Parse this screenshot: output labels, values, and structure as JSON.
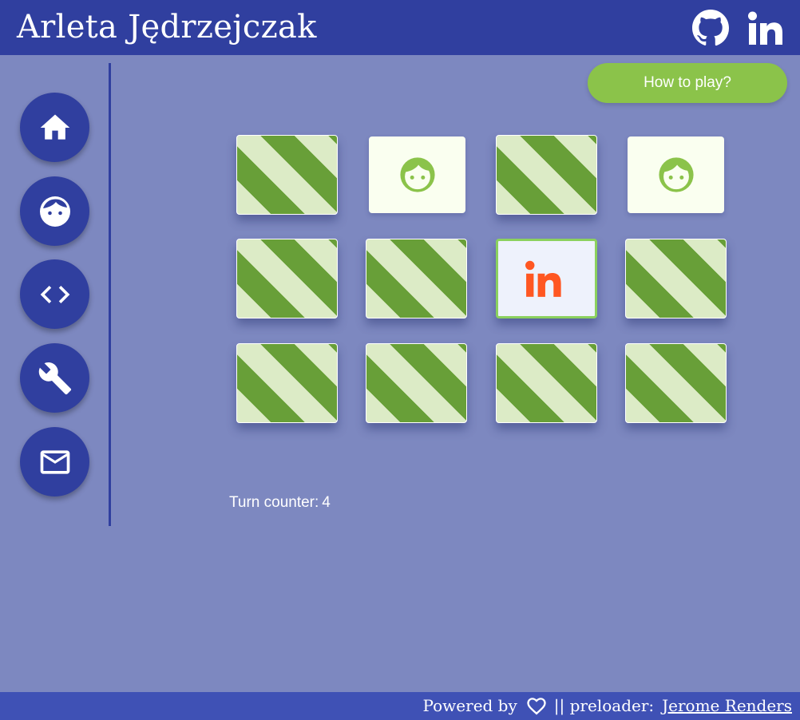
{
  "header": {
    "title": "Arleta Jędrzejczak",
    "icons": [
      "github-icon",
      "linkedin-icon"
    ]
  },
  "sidebar": {
    "items": [
      {
        "icon": "home-icon"
      },
      {
        "icon": "face-icon"
      },
      {
        "icon": "code-icon"
      },
      {
        "icon": "wrench-icon"
      },
      {
        "icon": "mail-icon"
      }
    ]
  },
  "game": {
    "how_to_play_label": "How to play?",
    "turn_counter_label": "Turn counter:",
    "turn_counter_value": "4",
    "cards": [
      {
        "state": "hidden"
      },
      {
        "state": "revealed",
        "icon": "face-icon"
      },
      {
        "state": "hidden"
      },
      {
        "state": "revealed",
        "icon": "face-icon"
      },
      {
        "state": "hidden"
      },
      {
        "state": "hidden"
      },
      {
        "state": "selected",
        "icon": "linkedin-icon"
      },
      {
        "state": "hidden"
      },
      {
        "state": "hidden"
      },
      {
        "state": "hidden"
      },
      {
        "state": "hidden"
      },
      {
        "state": "hidden"
      }
    ]
  },
  "footer": {
    "powered_by": "Powered by",
    "heart_icon": "heart-icon",
    "preloader_label": "|| preloader:",
    "preloader_link": "Jerome Renders"
  },
  "colors": {
    "header_bg": "#303f9f",
    "page_bg": "#7d88c0",
    "accent_green": "#8bc34a",
    "card_dark_green": "#689f38",
    "card_light_green": "#dcebc6",
    "linkedin_orange": "#ff5722",
    "footer_bg": "#3f51b5"
  }
}
